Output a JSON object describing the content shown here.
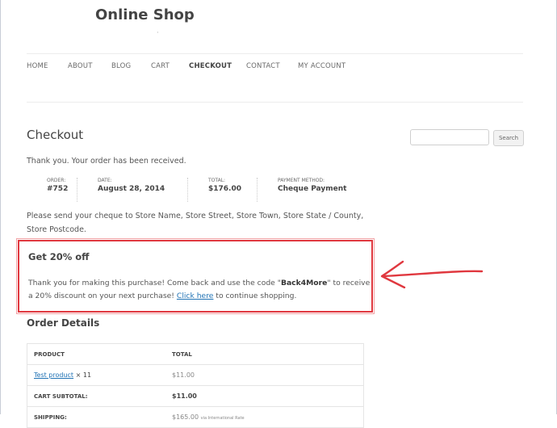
{
  "site": {
    "title": "Online Shop",
    "tagline_dot": "·"
  },
  "nav": {
    "items": [
      {
        "label": "HOME"
      },
      {
        "label": "ABOUT"
      },
      {
        "label": "BLOG"
      },
      {
        "label": "CART"
      },
      {
        "label": "CHECKOUT"
      },
      {
        "label": "CONTACT"
      },
      {
        "label": "MY ACCOUNT"
      }
    ],
    "active": "CHECKOUT"
  },
  "page": {
    "title": "Checkout",
    "thanks": "Thank you. Your order has been received.",
    "overview": {
      "order_label": "ORDER:",
      "order_value": "#752",
      "date_label": "DATE:",
      "date_value": "August 28, 2014",
      "total_label": "TOTAL:",
      "total_value": "$176.00",
      "payment_label": "PAYMENT METHOD:",
      "payment_value": "Cheque Payment"
    },
    "cheque_text": "Please send your cheque to Store Name, Store Street, Store Town, Store State / County, Store Postcode."
  },
  "promo": {
    "heading": "Get 20% off",
    "text_before": "Thank you for making this purchase! Come back and use the code \"",
    "code": "Back4More",
    "text_middle": "\" to receive a 20% discount on your next purchase! ",
    "link": "Click here",
    "text_after": " to continue shopping.",
    "accent_color": "#e0383f"
  },
  "order_details": {
    "title": "Order Details",
    "headers": {
      "product": "PRODUCT",
      "total": "TOTAL"
    },
    "rows": {
      "product_name": "Test product",
      "product_qty": "× 11",
      "product_total": "$11.00",
      "subtotal_label": "CART SUBTOTAL:",
      "subtotal_value": "$11.00",
      "shipping_label": "SHIPPING:",
      "shipping_value": "$165.00",
      "shipping_note": "via International Rate"
    }
  },
  "sidebar": {
    "search_button": "Search",
    "search_placeholder": ""
  },
  "annotation": {
    "arrow_color": "#e0383f"
  }
}
